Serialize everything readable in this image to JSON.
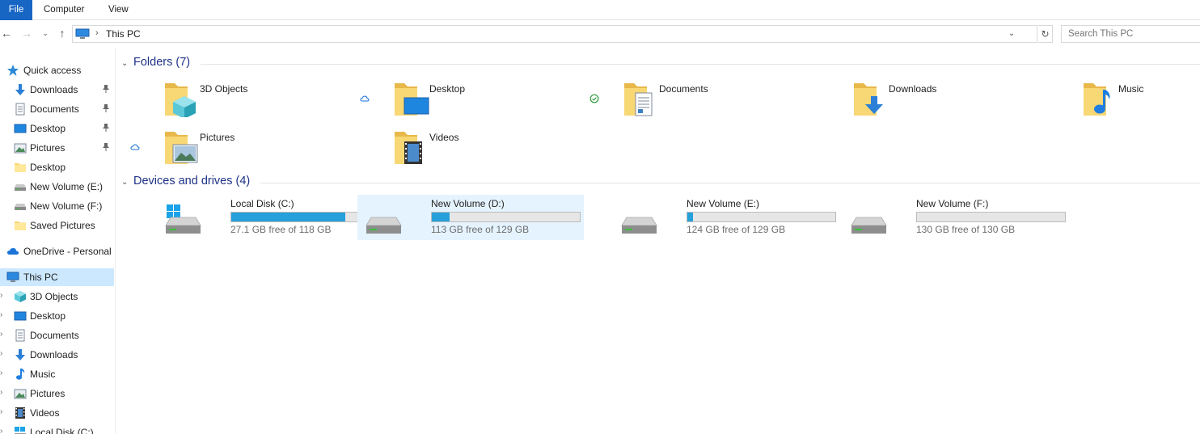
{
  "ribbon": {
    "file": "File",
    "computer": "Computer",
    "view": "View"
  },
  "address": {
    "crumb": "This PC",
    "search_placeholder": "Search This PC"
  },
  "sidebar": {
    "quick_access": "Quick access",
    "quick": [
      {
        "label": "Downloads",
        "icon": "download-arrow-icon",
        "pinned": true
      },
      {
        "label": "Documents",
        "icon": "document-icon",
        "pinned": true
      },
      {
        "label": "Desktop",
        "icon": "desktop-icon",
        "pinned": true
      },
      {
        "label": "Pictures",
        "icon": "pictures-icon",
        "pinned": true
      },
      {
        "label": "Desktop",
        "icon": "folder-icon",
        "pinned": false
      },
      {
        "label": "New Volume (E:)",
        "icon": "drive-icon",
        "pinned": false
      },
      {
        "label": "New Volume (F:)",
        "icon": "drive-icon",
        "pinned": false
      },
      {
        "label": "Saved Pictures",
        "icon": "folder-icon",
        "pinned": false
      }
    ],
    "onedrive": "OneDrive - Personal",
    "this_pc": "This PC",
    "pc_items": [
      {
        "label": "3D Objects",
        "icon": "3d-objects-icon"
      },
      {
        "label": "Desktop",
        "icon": "desktop-icon"
      },
      {
        "label": "Documents",
        "icon": "document-icon"
      },
      {
        "label": "Downloads",
        "icon": "download-arrow-icon"
      },
      {
        "label": "Music",
        "icon": "music-note-icon"
      },
      {
        "label": "Pictures",
        "icon": "pictures-icon"
      },
      {
        "label": "Videos",
        "icon": "film-icon"
      },
      {
        "label": "Local Disk (C:)",
        "icon": "windows-drive-icon"
      }
    ]
  },
  "folders": {
    "title": "Folders (7)",
    "items": [
      {
        "name": "3D Objects",
        "overlay": "3d"
      },
      {
        "name": "Desktop",
        "overlay": "desktop"
      },
      {
        "name": "Documents",
        "overlay": "document"
      },
      {
        "name": "Downloads",
        "overlay": "download"
      },
      {
        "name": "Music",
        "overlay": "music"
      },
      {
        "name": "Pictures",
        "overlay": "pictures"
      },
      {
        "name": "Videos",
        "overlay": "film"
      }
    ]
  },
  "drives": {
    "title": "Devices and drives (4)",
    "items": [
      {
        "name": "Local Disk (C:)",
        "free": "27.1 GB free of 118 GB",
        "used_fraction": 0.77,
        "system": true
      },
      {
        "name": "New Volume (D:)",
        "free": "113 GB free of 129 GB",
        "used_fraction": 0.12,
        "system": false
      },
      {
        "name": "New Volume (E:)",
        "free": "124 GB free of 129 GB",
        "used_fraction": 0.04,
        "system": false
      },
      {
        "name": "New Volume (F:)",
        "free": "130 GB free of 130 GB",
        "used_fraction": 0.0,
        "system": false
      }
    ]
  },
  "colors": {
    "accent": "#1766c4",
    "selection": "#cce8ff",
    "bar_fill": "#26a0da",
    "group_title": "#1e3287"
  }
}
